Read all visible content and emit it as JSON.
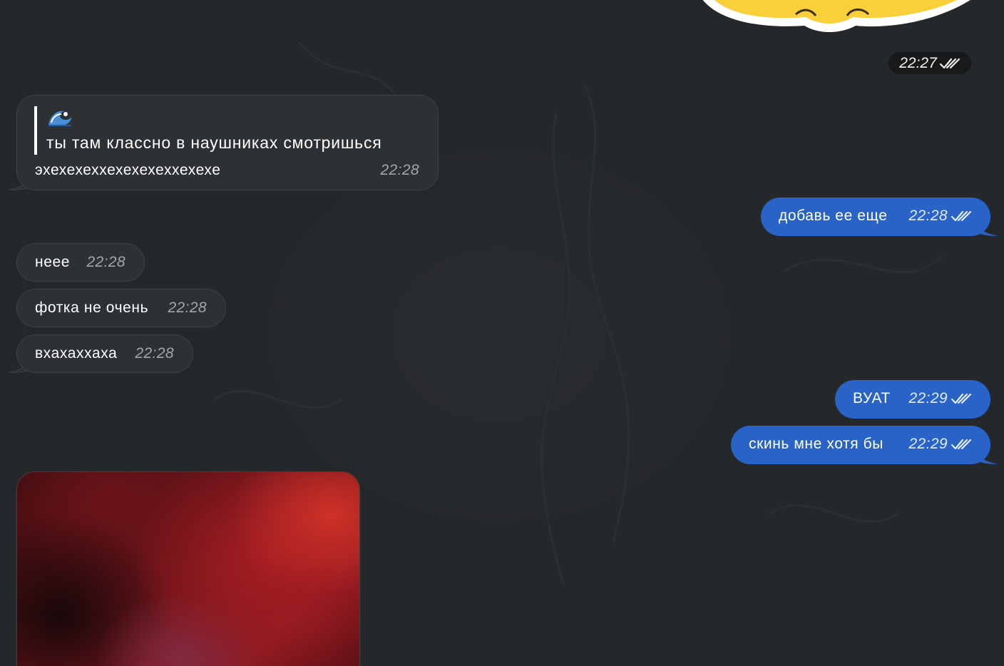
{
  "chat": {
    "service_time": "22:27",
    "incoming_reply": {
      "quote_emoji": "wave-emoji",
      "quote_text": "ты там классно в наушниках смотришься",
      "text": "эхехехеххехехехеххехехе",
      "time": "22:28"
    },
    "outgoing_1": {
      "text": "добавь ее еще",
      "time": "22:28"
    },
    "incoming_1": {
      "text": "неее",
      "time": "22:28"
    },
    "incoming_2": {
      "text": "фотка не очень",
      "time": "22:28"
    },
    "incoming_3": {
      "text": "вхахаххаха",
      "time": "22:28"
    },
    "outgoing_2": {
      "text": "ВУАТ",
      "time": "22:29"
    },
    "outgoing_3": {
      "text": "скинь мне хотя бы",
      "time": "22:29"
    }
  },
  "colors": {
    "background": "#25282b",
    "incoming_bubble": "#2e3134",
    "outgoing_bubble": "#2a63c8",
    "sticker": "#f9cf3a"
  },
  "icons": {
    "read_status": "double-check-icon",
    "photo": "photo-preview"
  }
}
